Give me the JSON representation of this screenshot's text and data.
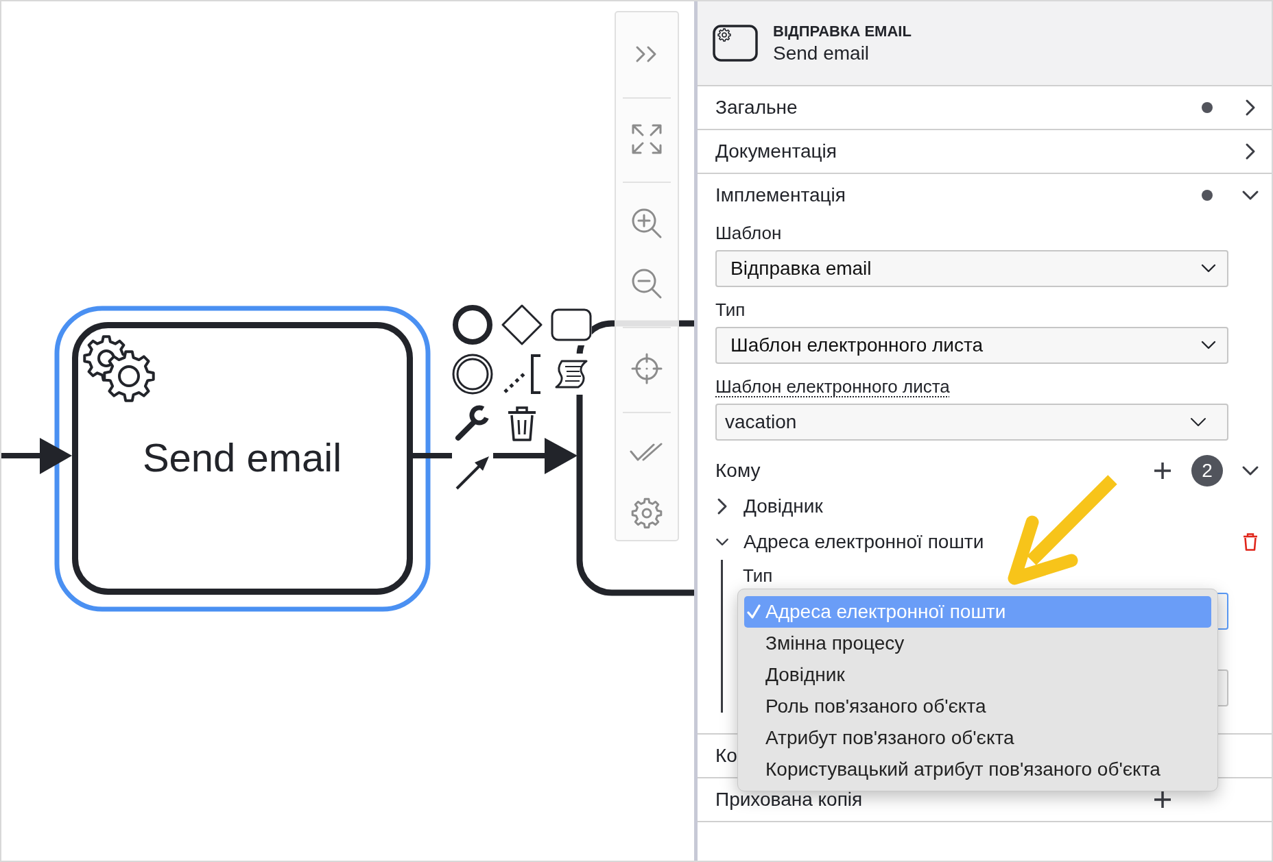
{
  "canvas": {
    "task": {
      "label": "Send email",
      "selected": true
    }
  },
  "panel": {
    "header": {
      "type": "ВІДПРАВКА EMAIL",
      "name": "Send email"
    },
    "groups": [
      {
        "kind": "section",
        "title": "Загальне",
        "has_data": true,
        "expanded": false
      },
      {
        "kind": "section",
        "title": "Документація",
        "has_data": false,
        "expanded": false
      },
      {
        "kind": "section",
        "title": "Імплементація",
        "has_data": true,
        "expanded": true,
        "fields": [
          {
            "kind": "select",
            "label": "Шаблон",
            "hint": false,
            "value": "Відправка email"
          },
          {
            "kind": "select",
            "label": "Тип",
            "hint": false,
            "value": "Шаблон електронного листа"
          },
          {
            "kind": "combobox",
            "label": "Шаблон електронного листа",
            "hint": true,
            "value": "vacation"
          },
          {
            "kind": "list",
            "title": "Кому",
            "add": true,
            "count": "2",
            "expanded": true,
            "items": [
              {
                "title": "Довідник",
                "expanded": false,
                "removable": false
              },
              {
                "title": "Адреса електронної пошти",
                "expanded": true,
                "removable": true,
                "fields": [
                  {
                    "kind": "select",
                    "label": "Тип",
                    "focused": true,
                    "options": [
                      {
                        "label": "Адреса електронної пошти",
                        "selected": true
                      },
                      {
                        "label": "Змінна процесу",
                        "selected": false
                      },
                      {
                        "label": "Довідник",
                        "selected": false
                      },
                      {
                        "label": "Роль пов'язаного об'єкта",
                        "selected": false
                      },
                      {
                        "label": "Атрибут пов'язаного об'єкта",
                        "selected": false
                      },
                      {
                        "label": "Користувацький атрибут пов'язаного об'єкта",
                        "selected": false
                      }
                    ]
                  },
                  {
                    "kind": "input",
                    "focused": false
                  }
                ]
              }
            ]
          }
        ]
      },
      {
        "kind": "list",
        "title": "Ко"
      },
      {
        "kind": "list",
        "title": "Прихована копія",
        "add": true
      }
    ]
  }
}
